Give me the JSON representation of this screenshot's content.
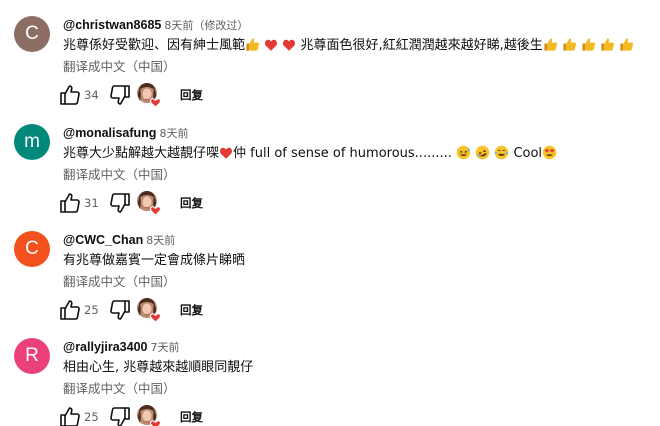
{
  "translate_label": "翻译成中文（中国）",
  "reply_label": "回复",
  "colors": {
    "avatar_c1": "#8d6e63",
    "avatar_m": "#00897b",
    "avatar_c2": "#f4511e",
    "avatar_r": "#ec407a",
    "heart": "#e53935",
    "thumb": "#f5b921"
  },
  "comments": [
    {
      "avatar_letter": "C",
      "author": "@christwan8685",
      "time": "8天前（修改过）",
      "text_1": "兆尊係好受歡迎、因有紳士風範",
      "text_2": "兆尊面色很好,紅紅潤潤越來越好睇,越後生",
      "likes": "34"
    },
    {
      "avatar_letter": "m",
      "author": "@monalisafung",
      "time": "8天前",
      "text_1": "兆尊大少點解越大越靚仔㗎",
      "text_2": "仲 full of sense of humorous.........",
      "text_3": "Cool",
      "likes": "31"
    },
    {
      "avatar_letter": "C",
      "author": "@CWC_Chan",
      "time": "8天前",
      "text_1": "有兆尊做嘉賓一定會成條片睇晒",
      "likes": "25"
    },
    {
      "avatar_letter": "R",
      "author": "@rallyjira3400",
      "time": "7天前",
      "text_1": "相由心生, 兆尊越來越順眼同靚仔",
      "likes": "25"
    }
  ]
}
